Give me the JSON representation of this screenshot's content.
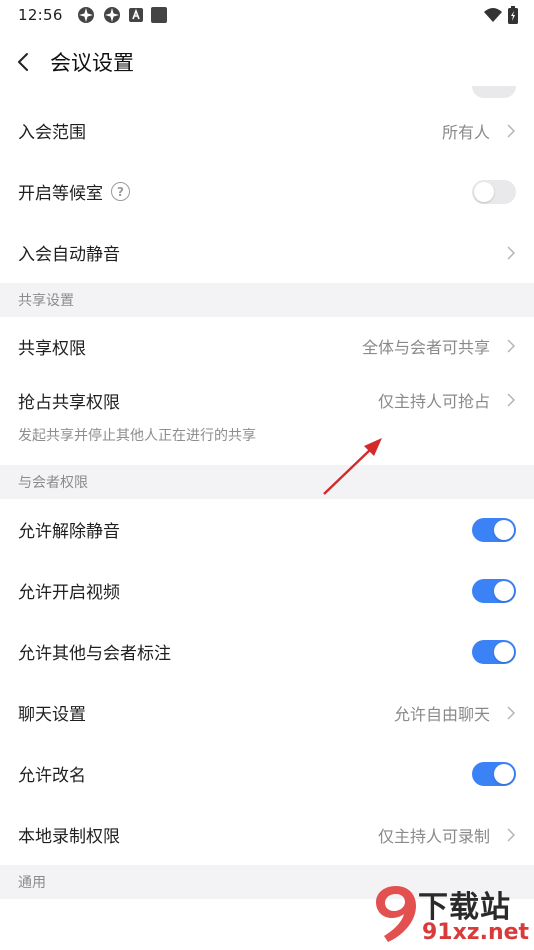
{
  "status": {
    "time": "12:56"
  },
  "nav": {
    "title": "会议设置"
  },
  "rows_top": [
    {
      "label": "入会范围",
      "value": "所有人",
      "kind": "link"
    },
    {
      "label": "开启等候室",
      "kind": "toggle",
      "on": false,
      "help": "?"
    },
    {
      "label": "入会自动静音",
      "kind": "link"
    }
  ],
  "section_share": {
    "title": "共享设置",
    "share_permission": {
      "label": "共享权限",
      "value": "全体与会者可共享"
    },
    "grab_permission": {
      "label": "抢占共享权限",
      "value": "仅主持人可抢占"
    },
    "grab_desc": "发起共享并停止其他人正在进行的共享"
  },
  "section_participant": {
    "title": "与会者权限",
    "rows": [
      {
        "label": "允许解除静音",
        "kind": "toggle",
        "on": true
      },
      {
        "label": "允许开启视频",
        "kind": "toggle",
        "on": true
      },
      {
        "label": "允许其他与会者标注",
        "kind": "toggle",
        "on": true
      },
      {
        "label": "聊天设置",
        "value": "允许自由聊天",
        "kind": "link"
      },
      {
        "label": "允许改名",
        "kind": "toggle",
        "on": true
      },
      {
        "label": "本地录制权限",
        "value": "仅主持人可录制",
        "kind": "link"
      }
    ]
  },
  "section_general": {
    "title": "通用"
  },
  "watermark": {
    "brand": "下载站",
    "site": "91xz.net"
  },
  "colors": {
    "accent": "#3b82f6",
    "toggle_off": "#e9e9ec",
    "arrow": "#d42a2a"
  }
}
